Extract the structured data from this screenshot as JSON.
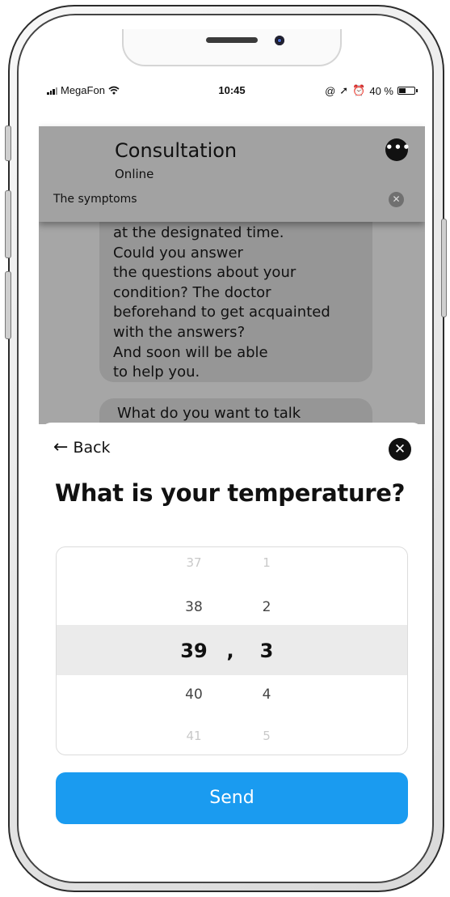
{
  "status_bar": {
    "carrier": "MegaFon",
    "wifi_icon": "wifi-icon",
    "time": "10:45",
    "battery_percent": "40 %",
    "indicators": [
      "@",
      "➚",
      "⏰"
    ]
  },
  "chat": {
    "title": "Consultation",
    "status": "Online",
    "more_icon": "more-icon",
    "symptoms_label": "The symptoms",
    "message_lines": [
      "at the designated time.",
      "Could you answer",
      "the questions about your",
      "condition? The doctor",
      "beforehand to get acquainted",
      "with the answers?",
      "And soon will be able",
      "to help you."
    ],
    "next_message_partial": "What do you want to talk"
  },
  "sheet": {
    "back_label": "Back",
    "question": "What is your temperature?",
    "picker": {
      "rows": [
        {
          "int": "37",
          "dec": "1"
        },
        {
          "int": "38",
          "dec": "2"
        },
        {
          "int": "39",
          "dec": "3"
        },
        {
          "int": "40",
          "dec": "4"
        },
        {
          "int": "41",
          "dec": "5"
        }
      ],
      "separator": ",",
      "selected_index": 2
    },
    "send_label": "Send"
  },
  "colors": {
    "accent": "#1a9bf0",
    "overlay": "#a2a2a2",
    "highlight": "#ebebeb"
  }
}
